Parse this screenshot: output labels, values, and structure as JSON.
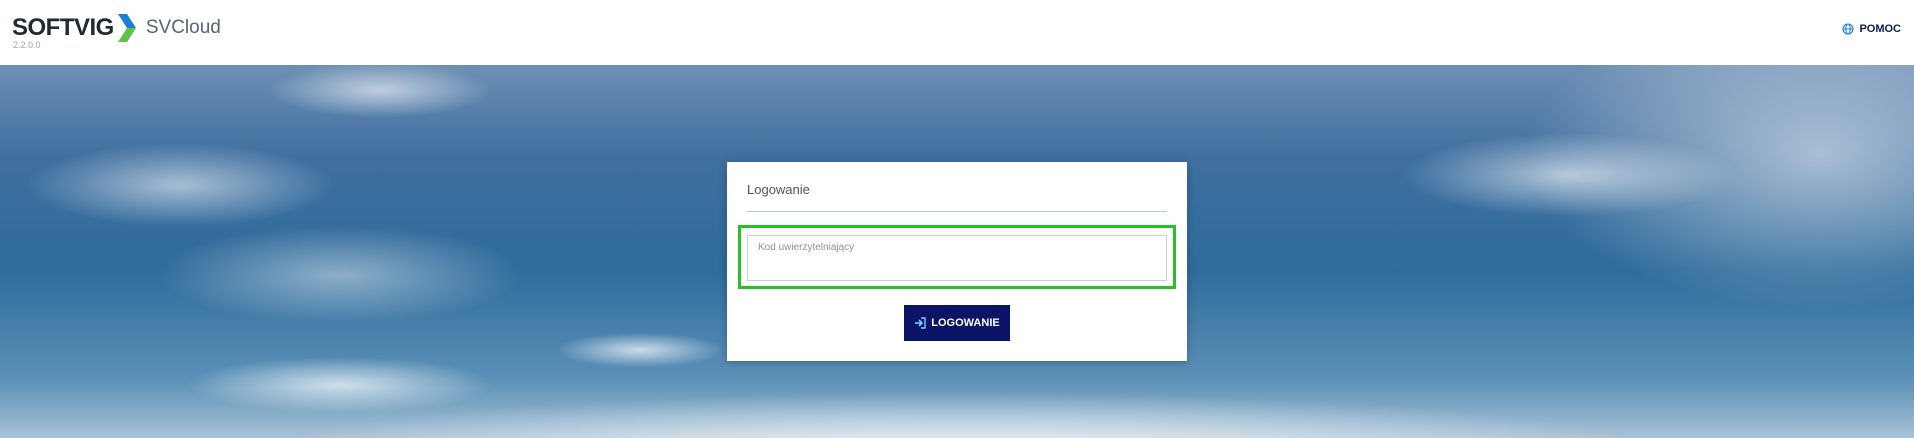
{
  "header": {
    "brand": "SOFTVIG",
    "product": "SVCloud",
    "version": "2.2.0.0",
    "help_label": "POMOC",
    "help_icon": "globe-icon"
  },
  "login": {
    "title": "Logowanie",
    "code_placeholder": "Kod uwierzytelniający",
    "code_value": "",
    "button_label": "LOGOWANIE",
    "button_icon": "sign-in-icon"
  },
  "colors": {
    "accent": "#0b1466",
    "highlight": "#22c322",
    "logo_chevron_blue": "#1e7bd6",
    "logo_chevron_green": "#62c04a"
  }
}
